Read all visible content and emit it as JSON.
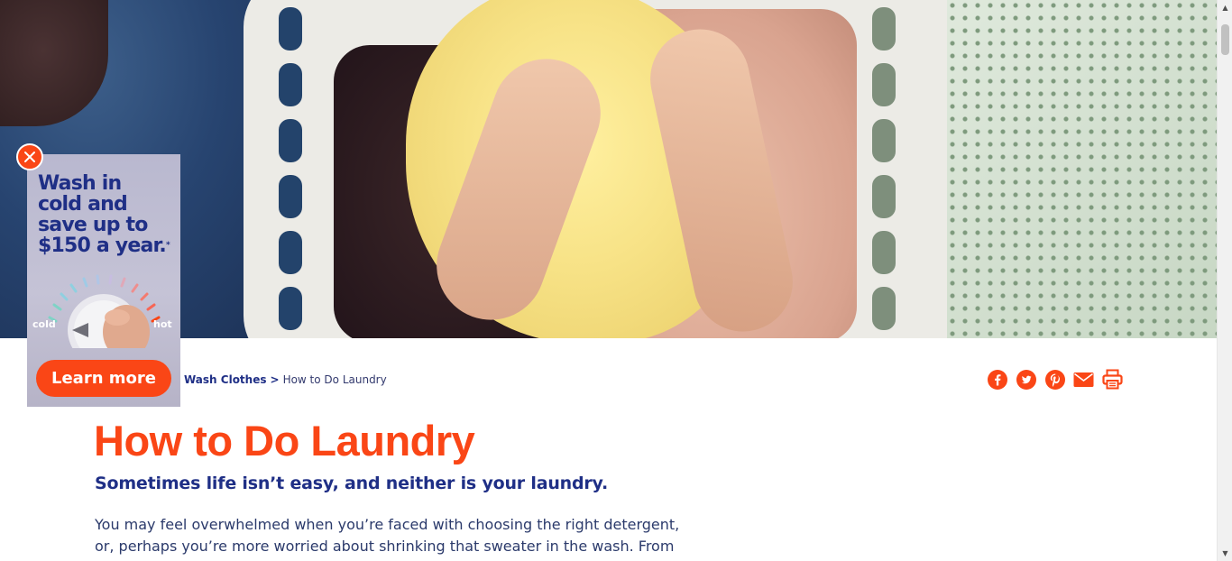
{
  "breadcrumb": {
    "parent": "Wash Clothes",
    "separator": ">",
    "current": "How to Do Laundry"
  },
  "share": {
    "icons": [
      "facebook-icon",
      "twitter-icon",
      "pinterest-icon",
      "email-icon",
      "print-icon"
    ],
    "color": "#fa4616"
  },
  "article": {
    "title": "How to Do Laundry",
    "subtitle": "Sometimes life isn’t easy, and neither is your laundry.",
    "body_line1": "You may feel overwhelmed when you’re faced with choosing the right detergent,",
    "body_line2": "or, perhaps you’re more worried about shrinking that sweater in the wash. From"
  },
  "ad": {
    "headline_1": "Wash in",
    "headline_2": "cold and",
    "headline_3": "save up to",
    "headline_4": "$150 a year.",
    "footnote_mark": "*",
    "dial_cold_label": "cold",
    "dial_hot_label": "hot",
    "cta_label": "Learn more",
    "close_icon": "close-icon"
  },
  "colors": {
    "brand_orange": "#fa4616",
    "brand_navy": "#1f2f86"
  }
}
